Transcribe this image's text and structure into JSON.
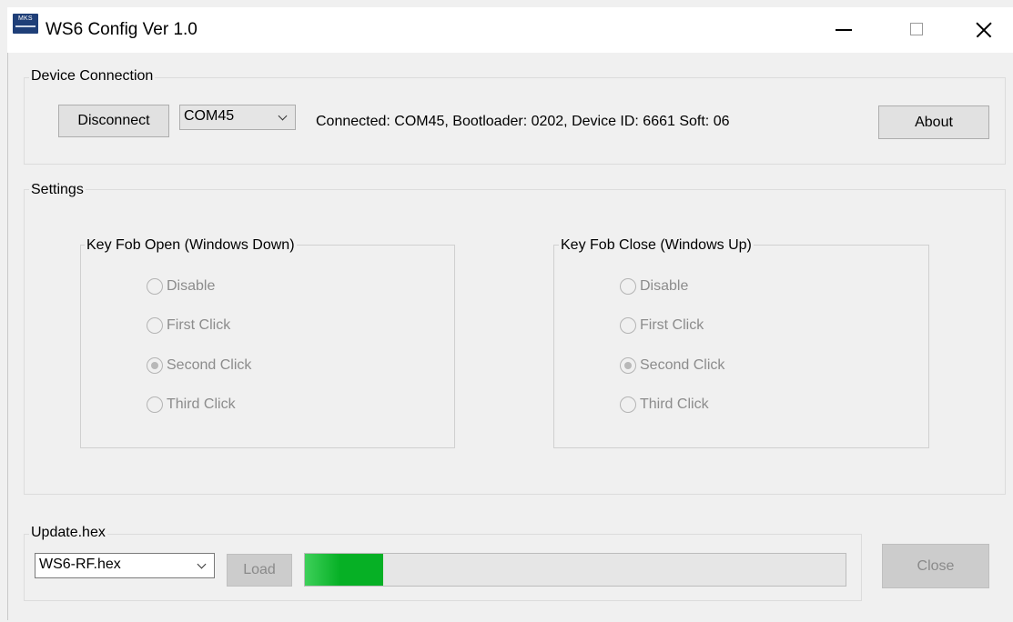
{
  "window": {
    "title": "WS6 Config Ver 1.0",
    "icon_text": "MKS"
  },
  "device_connection": {
    "label": "Device Connection",
    "disconnect_label": "Disconnect",
    "port_value": "COM45",
    "status_text": "Connected: COM45, Bootloader: 0202, Device ID: 6661 Soft: 06",
    "about_label": "About"
  },
  "settings": {
    "label": "Settings",
    "open_group": {
      "label": "Key Fob Open (Windows Down)",
      "options": [
        "Disable",
        "First Click",
        "Second Click",
        "Third Click"
      ],
      "selected": "Second Click"
    },
    "close_group": {
      "label": "Key Fob Close (Windows Up)",
      "options": [
        "Disable",
        "First Click",
        "Second Click",
        "Third Click"
      ],
      "selected": "Second Click"
    }
  },
  "update": {
    "label": "Update.hex",
    "file_value": "WS6-RF.hex",
    "load_label": "Load",
    "progress_fraction": 0.145,
    "close_label": "Close"
  },
  "colors": {
    "progress_green": "#06b025",
    "disabled_text": "#8c8c8c"
  }
}
